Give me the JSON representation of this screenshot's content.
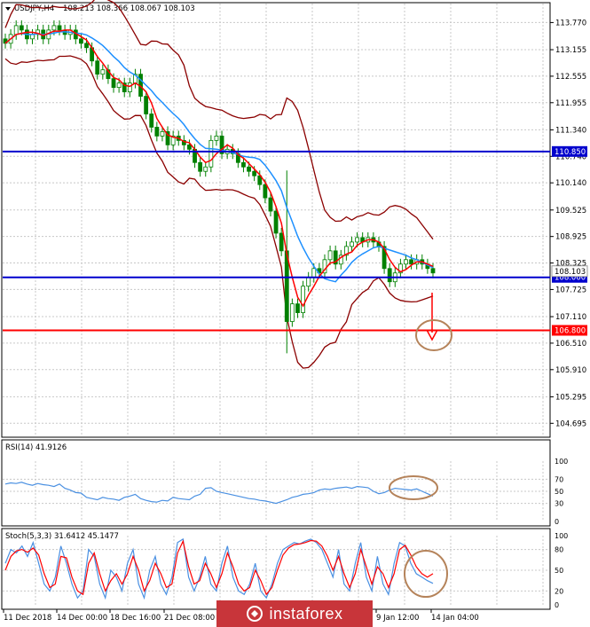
{
  "header": {
    "symbol": "USDJPY,H4",
    "ohlc": "108.213 108.366 108.067 108.103"
  },
  "colors": {
    "frame": "#000000",
    "grid": "#c8c8c8",
    "candle": "#008000",
    "ma_fast": "#ff0000",
    "ma_slow": "#1e90ff",
    "bollinger": "#8b0000",
    "support_blue": "#0000cd",
    "target_red": "#ff0000",
    "annotation": "#b5835a",
    "rsi": "#4a90e2",
    "stoch_main": "#4a90e2",
    "stoch_signal": "#ff0000"
  },
  "price_axis": {
    "labels": [
      "113.770",
      "113.155",
      "112.555",
      "111.955",
      "111.340",
      "110.740",
      "110.140",
      "109.525",
      "108.925",
      "108.325",
      "107.725",
      "107.110",
      "106.510",
      "105.910",
      "105.295",
      "104.695"
    ]
  },
  "levels": [
    {
      "price": 110.85,
      "label": "110.850",
      "color": "#0000cd"
    },
    {
      "price": 108.0,
      "label": "108.000",
      "color": "#0000cd"
    },
    {
      "price": 106.8,
      "label": "106.800",
      "color": "#ff0000"
    }
  ],
  "current_price_label": "108.103",
  "time_axis": {
    "labels": [
      "11 Dec 2018",
      "14 Dec 00:00",
      "18 Dec 16:00",
      "21 Dec 08:00",
      "9 Jan 12:00",
      "14 Jan 04:00"
    ]
  },
  "rsi": {
    "title": "RSI(14) 41.9126",
    "levels": [
      "100",
      "70",
      "50",
      "30",
      "0"
    ]
  },
  "stoch": {
    "title": "Stoch(5,3,3) 31.6412 45.1477",
    "levels": [
      "100",
      "80",
      "50",
      "20",
      "0"
    ]
  },
  "chart_data": {
    "type": "candlestick",
    "symbol": "USDJPY",
    "timeframe": "H4",
    "ylim": [
      104.4,
      114.2
    ],
    "close": [
      113.3,
      113.5,
      113.7,
      113.6,
      113.4,
      113.5,
      113.6,
      113.4,
      113.6,
      113.7,
      113.6,
      113.5,
      113.6,
      113.4,
      113.3,
      113.2,
      112.9,
      112.6,
      112.7,
      112.5,
      112.3,
      112.4,
      112.2,
      112.4,
      112.6,
      112.1,
      111.7,
      111.4,
      111.2,
      111.3,
      111.0,
      111.2,
      111.1,
      111.0,
      110.9,
      110.6,
      110.4,
      110.5,
      111.1,
      111.2,
      110.8,
      110.9,
      110.8,
      110.6,
      110.5,
      110.4,
      110.3,
      110.1,
      109.8,
      109.5,
      109.0,
      108.6,
      107.0,
      107.4,
      107.2,
      107.8,
      108.0,
      108.2,
      108.1,
      108.4,
      108.6,
      108.3,
      108.5,
      108.7,
      108.8,
      108.9,
      108.8,
      108.9,
      108.8,
      108.7,
      108.2,
      107.9,
      108.1,
      108.3,
      108.4,
      108.3,
      108.4,
      108.3,
      108.2,
      108.1
    ],
    "target_price": 106.8,
    "support_price": 108.0,
    "resistance_price": 110.85,
    "rsi": {
      "name": "RSI(14)",
      "last": 41.9126,
      "ylim": [
        0,
        100
      ],
      "levels": [
        30,
        50,
        70
      ],
      "values": [
        62,
        64,
        63,
        65,
        62,
        60,
        63,
        61,
        60,
        58,
        62,
        55,
        52,
        48,
        47,
        40,
        38,
        36,
        40,
        38,
        37,
        35,
        40,
        42,
        45,
        38,
        35,
        33,
        32,
        35,
        34,
        40,
        38,
        37,
        36,
        42,
        45,
        55,
        56,
        50,
        48,
        46,
        44,
        42,
        40,
        38,
        37,
        35,
        34,
        32,
        30,
        33,
        36,
        40,
        42,
        45,
        46,
        48,
        52,
        54,
        53,
        55,
        56,
        57,
        55,
        58,
        57,
        56,
        50,
        46,
        48,
        52,
        55,
        54,
        53,
        52,
        54,
        50,
        46,
        42
      ]
    },
    "stochastic": {
      "name": "Stoch(5,3,3)",
      "main_last": 31.6412,
      "signal_last": 45.1477,
      "ylim": [
        0,
        100
      ],
      "levels": [
        20,
        50,
        80
      ],
      "main": [
        60,
        80,
        75,
        85,
        70,
        90,
        60,
        30,
        20,
        40,
        85,
        60,
        30,
        10,
        20,
        80,
        70,
        30,
        10,
        50,
        40,
        20,
        60,
        80,
        30,
        10,
        50,
        70,
        30,
        15,
        40,
        90,
        95,
        40,
        20,
        40,
        70,
        30,
        20,
        60,
        85,
        40,
        20,
        15,
        30,
        60,
        20,
        10,
        30,
        60,
        80,
        85,
        90,
        88,
        92,
        95,
        90,
        80,
        60,
        40,
        80,
        30,
        20,
        60,
        90,
        40,
        20,
        70,
        30,
        15,
        60,
        90,
        85,
        60,
        45,
        40,
        35,
        31
      ],
      "signal": [
        50,
        70,
        78,
        80,
        76,
        82,
        72,
        45,
        25,
        30,
        70,
        68,
        40,
        20,
        15,
        60,
        75,
        45,
        20,
        35,
        45,
        30,
        45,
        70,
        50,
        20,
        35,
        60,
        45,
        25,
        30,
        75,
        92,
        55,
        30,
        35,
        60,
        45,
        25,
        45,
        75,
        55,
        30,
        20,
        25,
        50,
        35,
        15,
        25,
        50,
        72,
        82,
        87,
        88,
        90,
        93,
        92,
        85,
        70,
        50,
        70,
        45,
        25,
        45,
        80,
        55,
        30,
        55,
        45,
        25,
        45,
        80,
        86,
        72,
        55,
        45,
        40,
        45
      ]
    }
  }
}
